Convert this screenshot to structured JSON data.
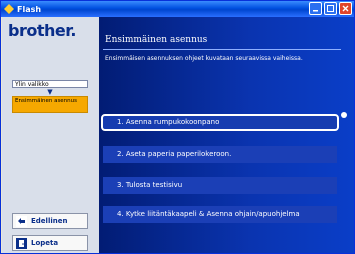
{
  "window": {
    "title": "Flash"
  },
  "sidebar": {
    "logo": "brother.",
    "menu": {
      "item": "Ylin valikko",
      "active": "Ensimmäinen asennus"
    }
  },
  "nav": {
    "back": "Edellinen",
    "exit": "Lopeta"
  },
  "main": {
    "heading": "Ensimmäinen asennus",
    "subtitle": "Ensimmäisen asennuksen ohjeet kuvataan seuraavissa vaiheissa.",
    "options": [
      "1. Asenna rumpukokoonpano",
      "2. Aseta paperia paperilokeroon.",
      "3. Tulosta testisivu",
      "4. Kytke liitäntäkaapeli & Asenna ohjain/apuohjelma"
    ]
  },
  "colors": {
    "accent": "#f6a800",
    "title_bar": "#0050e0",
    "panel": "#0a34b0"
  }
}
